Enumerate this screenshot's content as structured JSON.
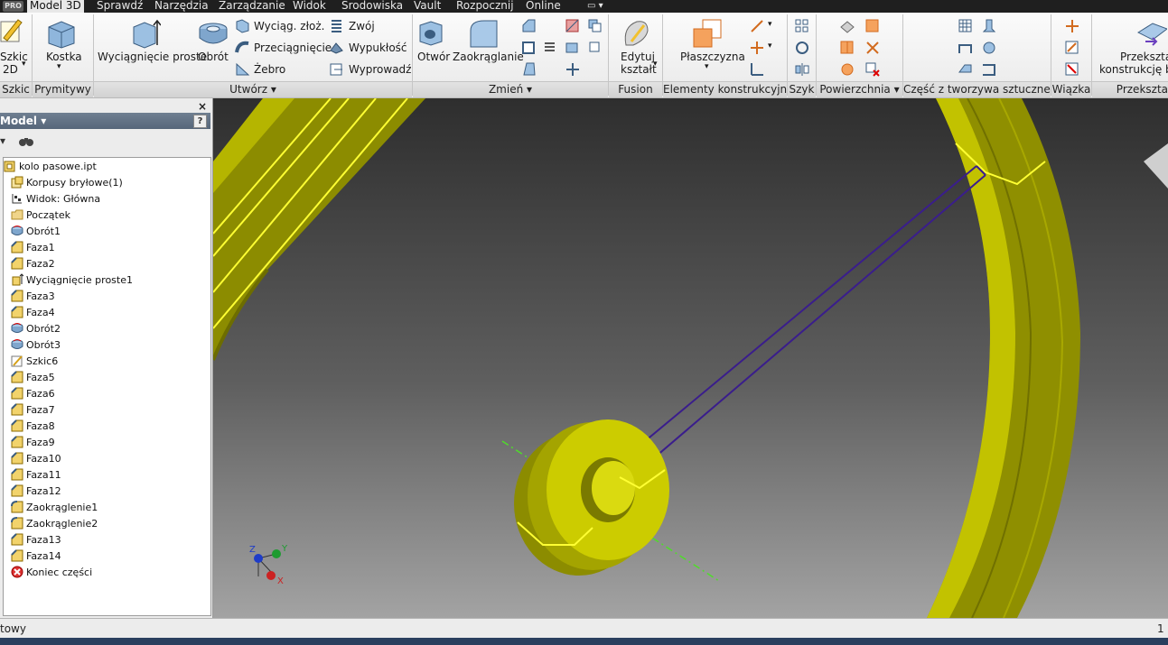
{
  "menu": {
    "pro_badge": "PRO",
    "tabs": [
      "Model 3D",
      "Sprawdź",
      "Narzędzia",
      "Zarządzanie",
      "Widok",
      "Środowiska",
      "Vault",
      "Rozpocznij",
      "Online"
    ]
  },
  "ribbon": {
    "panels": {
      "szkic": "Szkic",
      "prymitywy": "Prymitywy",
      "utworz": "Utwórz ▾",
      "zmien": "Zmień ▾",
      "fusion": "Fusion",
      "elementy": "Elementy konstrukcyjne",
      "szyk": "Szyk",
      "powierzchnia": "Powierzchnia ▾",
      "czesc": "Część z tworzywa sztucznego",
      "wiazka": "Wiązka",
      "przeksztalc": "Przekszta"
    },
    "buttons": {
      "szkic_line1": "Szkic",
      "szkic_line2": "2D",
      "kostka": "Kostka",
      "wyciagniecie": "Wyciągnięcie proste",
      "obrot": "Obrót",
      "wyciag_zloz": "Wyciąg. złoż.",
      "przeciagniecie": "Przeciągnięcie",
      "zebro": "Żebro",
      "zwoj": "Zwój",
      "wypuklosc": "Wypukłość",
      "wyprowadz": "Wyprowadź",
      "otwor": "Otwór",
      "zaokraglanie": "Zaokrąglanie",
      "edytuj_line1": "Edytuj",
      "edytuj_line2": "kształt",
      "plaszczyzna": "Płaszczyzna",
      "przeksztalc_line1": "Przekształć",
      "przeksztalc_line2": "konstrukcję bla"
    }
  },
  "browser": {
    "title": "Model ▾",
    "help": "?",
    "close": "×",
    "binoculars": "find-icon",
    "items": [
      {
        "label": "kolo pasowe.ipt",
        "icon": "part-file-icon"
      },
      {
        "label": "Korpusy bryłowe(1)",
        "icon": "solid-bodies-icon"
      },
      {
        "label": "Widok: Główna",
        "icon": "view-rep-icon"
      },
      {
        "label": "Początek",
        "icon": "origin-folder-icon"
      },
      {
        "label": "Obrót1",
        "icon": "revolve-icon"
      },
      {
        "label": "Faza1",
        "icon": "chamfer-icon"
      },
      {
        "label": "Faza2",
        "icon": "chamfer-icon"
      },
      {
        "label": "Wyciągnięcie proste1",
        "icon": "extrude-icon"
      },
      {
        "label": "Faza3",
        "icon": "chamfer-icon"
      },
      {
        "label": "Faza4",
        "icon": "chamfer-icon"
      },
      {
        "label": "Obrót2",
        "icon": "revolve-icon"
      },
      {
        "label": "Obrót3",
        "icon": "revolve-icon"
      },
      {
        "label": "Szkic6",
        "icon": "sketch-icon"
      },
      {
        "label": "Faza5",
        "icon": "chamfer-icon"
      },
      {
        "label": "Faza6",
        "icon": "chamfer-icon"
      },
      {
        "label": "Faza7",
        "icon": "chamfer-icon"
      },
      {
        "label": "Faza8",
        "icon": "chamfer-icon"
      },
      {
        "label": "Faza9",
        "icon": "chamfer-icon"
      },
      {
        "label": "Faza10",
        "icon": "chamfer-icon"
      },
      {
        "label": "Faza11",
        "icon": "chamfer-icon"
      },
      {
        "label": "Faza12",
        "icon": "chamfer-icon"
      },
      {
        "label": "Zaokrąglenie1",
        "icon": "fillet-icon"
      },
      {
        "label": "Zaokrąglenie2",
        "icon": "fillet-icon"
      },
      {
        "label": "Faza13",
        "icon": "chamfer-icon"
      },
      {
        "label": "Faza14",
        "icon": "chamfer-icon"
      },
      {
        "label": "Koniec części",
        "icon": "end-of-part-icon"
      }
    ]
  },
  "viewport": {
    "axes": {
      "x": "X",
      "y": "Y",
      "z": "Z"
    }
  },
  "status": {
    "left": "towy",
    "right": "1"
  },
  "colors": {
    "part": "#c8c800",
    "edge_highlight": "#ffff33",
    "sketch": "#3a1d8c",
    "axis": "#4fdc2a"
  }
}
